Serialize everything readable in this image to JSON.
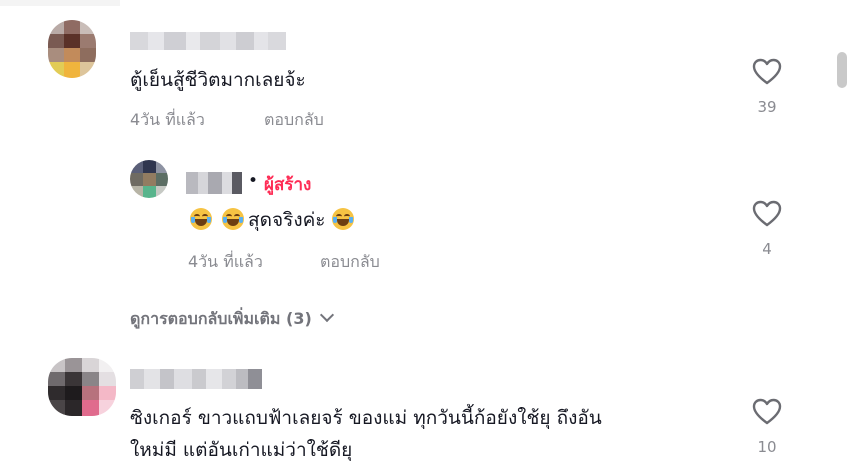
{
  "comments": [
    {
      "text": "ตู้เย็นสู้ชีวิตมากเลยจ้ะ",
      "time": "4วัน ที่แล้ว",
      "reply_label": "ตอบกลับ",
      "likes": "39",
      "heart_icon": "heart-outline-icon"
    },
    {
      "text_suffix": "สุดจริงค่ะ",
      "creator_badge": "ผู้สร้าง",
      "dot": "•",
      "time": "4วัน ที่แล้ว",
      "reply_label": "ตอบกลับ",
      "likes": "4",
      "emoji_icon": "laughing-tears-emoji-icon"
    },
    {
      "text_line1": "ซิงเกอร์ ขาวแถบฟ้าเลยจร้ ของแม่ ทุกวันนี้ก้อยังใช้ยุ ถึงอัน",
      "text_line2": "ใหม่มี แต่อันเก่าแม่ว่าใช้ดียุ",
      "likes": "10"
    }
  ],
  "view_more_replies": "ดูการตอบกลับเพิ่มเติม (3)",
  "colors": {
    "accent": "#fe2c55",
    "text": "#161823",
    "muted": "#8a8b91"
  }
}
